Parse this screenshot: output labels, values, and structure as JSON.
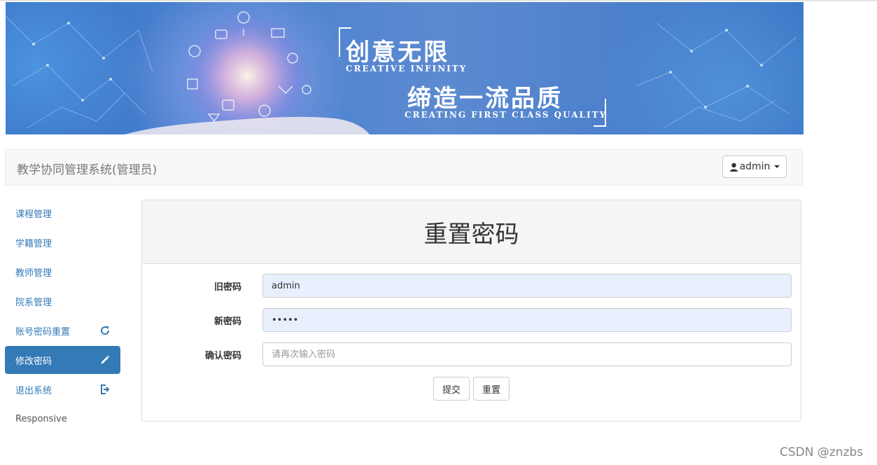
{
  "banner": {
    "slogan_cn_1": "创意无限",
    "slogan_en_1": "CREATIVE INFINITY",
    "slogan_cn_2": "缔造一流品质",
    "slogan_en_2": "CREATING FIRST CLASS QUALITY"
  },
  "navbar": {
    "brand": "教学协同管理系统(管理员)",
    "user_label": "admin"
  },
  "sidebar": {
    "items": [
      {
        "label": "课程管理"
      },
      {
        "label": "学籍管理"
      },
      {
        "label": "教师管理"
      },
      {
        "label": "院系管理"
      },
      {
        "label": "账号密码重置",
        "icon": "refresh-icon"
      },
      {
        "label": "修改密码",
        "icon": "pencil-icon",
        "active": true
      },
      {
        "label": "退出系统",
        "icon": "logout-icon"
      },
      {
        "label": "Responsive"
      }
    ]
  },
  "form": {
    "title": "重置密码",
    "old_label": "旧密码",
    "old_value": "admin",
    "new_label": "新密码",
    "new_value": "•••••",
    "confirm_label": "确认密码",
    "confirm_placeholder": "请再次输入密码",
    "submit_label": "提交",
    "reset_label": "重置"
  },
  "watermark": "CSDN @znzbs",
  "colors": {
    "primary": "#337ab7",
    "autofill_bg": "#e8f0fe",
    "banner_blue": "#4a82cf"
  }
}
